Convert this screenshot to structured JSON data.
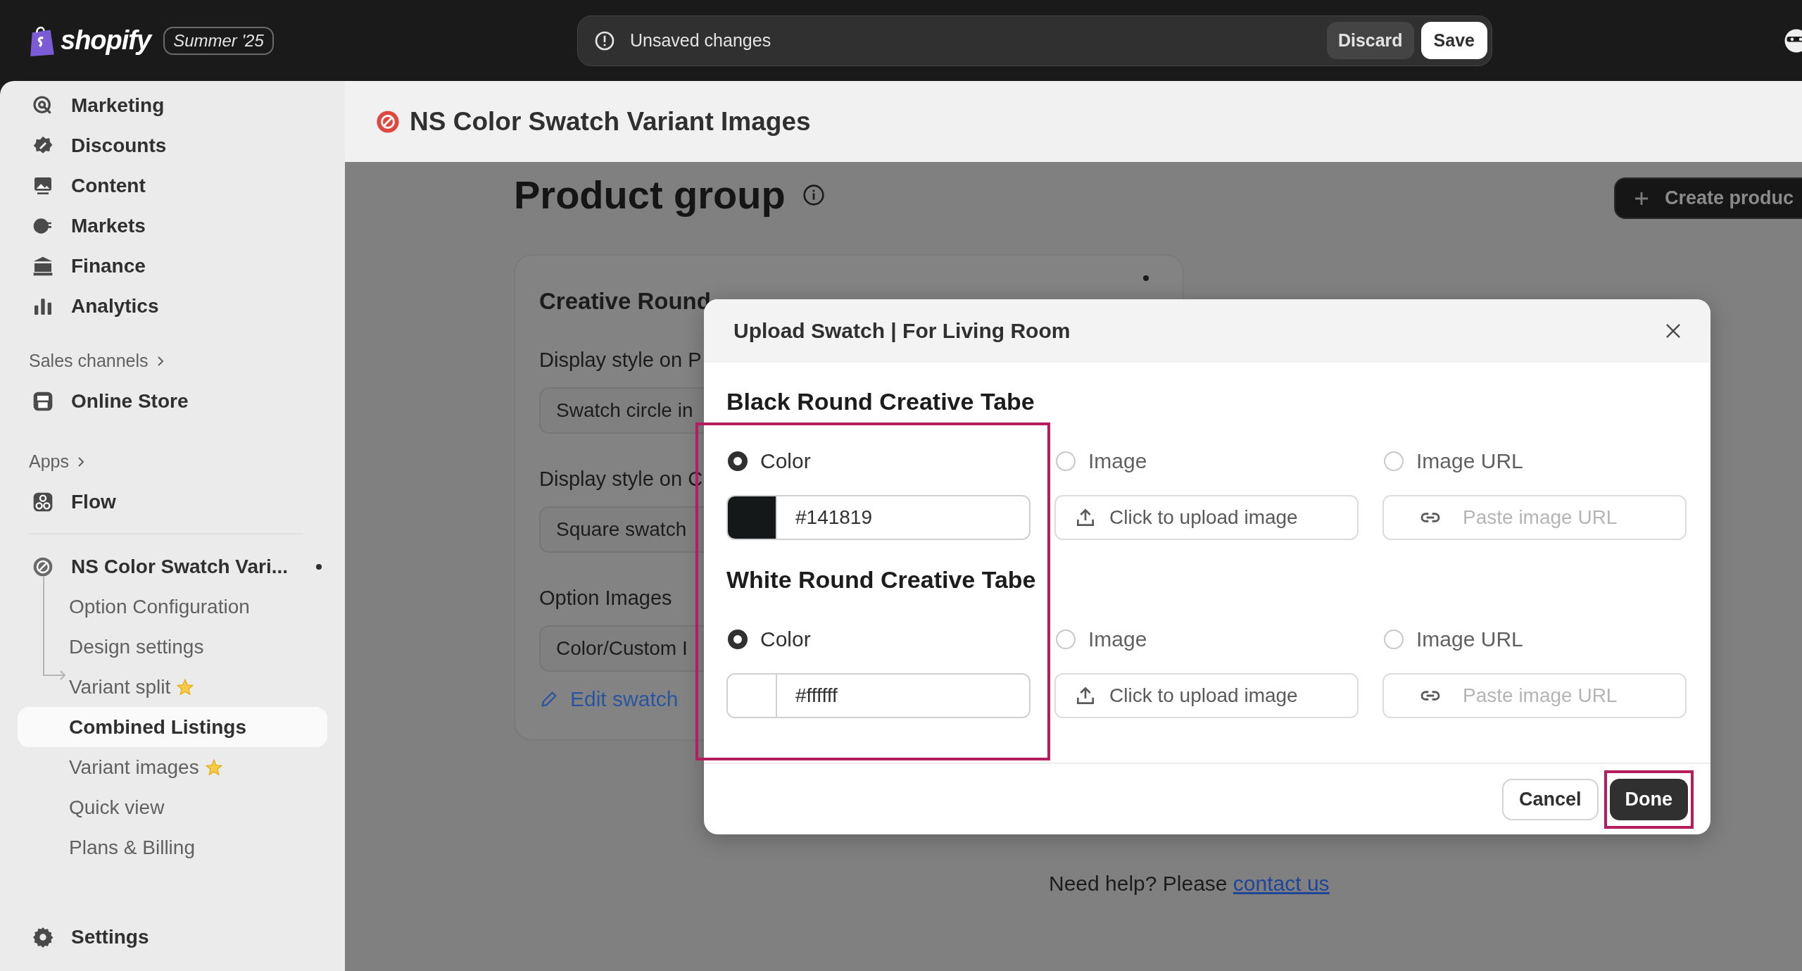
{
  "top_bar": {
    "logo": "shopify",
    "badge": "Summer '25",
    "unsaved": {
      "message": "Unsaved changes",
      "discard": "Discard",
      "save": "Save"
    }
  },
  "sidebar": {
    "items": [
      {
        "label": "Marketing"
      },
      {
        "label": "Discounts"
      },
      {
        "label": "Content"
      },
      {
        "label": "Markets"
      },
      {
        "label": "Finance"
      },
      {
        "label": "Analytics"
      }
    ],
    "sales_channels": {
      "label": "Sales channels",
      "items": [
        {
          "label": "Online Store"
        }
      ]
    },
    "apps": {
      "label": "Apps",
      "items": [
        {
          "label": "Flow"
        }
      ]
    },
    "app": {
      "name": "NS Color Swatch Vari...",
      "unsaved": true,
      "children": [
        {
          "label": "Option Configuration",
          "starred": false,
          "selected": false
        },
        {
          "label": "Design settings",
          "starred": false,
          "selected": false
        },
        {
          "label": "Variant split",
          "starred": true,
          "selected": false
        },
        {
          "label": "Combined Listings",
          "starred": false,
          "selected": true
        },
        {
          "label": "Variant images",
          "starred": true,
          "selected": false
        },
        {
          "label": "Quick view",
          "starred": false,
          "selected": false
        },
        {
          "label": "Plans & Billing",
          "starred": false,
          "selected": false
        }
      ]
    },
    "settings": "Settings"
  },
  "app_header": {
    "title": "NS Color Swatch Variant Images"
  },
  "page": {
    "title": "Product group",
    "create_button": "Create produc",
    "card": {
      "title": "Creative Round",
      "fields": [
        {
          "label": "Display style on P",
          "value": "Swatch circle in"
        },
        {
          "label": "Display style on C",
          "value": "Square swatch"
        },
        {
          "label": "Option Images",
          "value": "Color/Custom I"
        }
      ],
      "link": "Edit swatch"
    },
    "help": {
      "text": "Need help? Please",
      "link": "contact us"
    }
  },
  "modal": {
    "title": "Upload Swatch | For Living Room",
    "variants": [
      {
        "name": "Black Round Creative Tabe",
        "options": [
          {
            "kind": "color",
            "label": "Color",
            "selected": true,
            "value": "#141819",
            "color": "#141819"
          },
          {
            "kind": "image",
            "label": "Image",
            "selected": false,
            "placeholder": "Click to upload image"
          },
          {
            "kind": "url",
            "label": "Image URL",
            "selected": false,
            "placeholder": "Paste image URL"
          }
        ]
      },
      {
        "name": "White Round Creative Tabe",
        "options": [
          {
            "kind": "color",
            "label": "Color",
            "selected": true,
            "value": "#ffffff",
            "color": "#ffffff"
          },
          {
            "kind": "image",
            "label": "Image",
            "selected": false,
            "placeholder": "Click to upload image"
          },
          {
            "kind": "url",
            "label": "Image URL",
            "selected": false,
            "placeholder": "Paste image URL"
          }
        ]
      }
    ],
    "cancel": "Cancel",
    "done": "Done",
    "highlight_color_column": true,
    "highlight_done": true
  }
}
